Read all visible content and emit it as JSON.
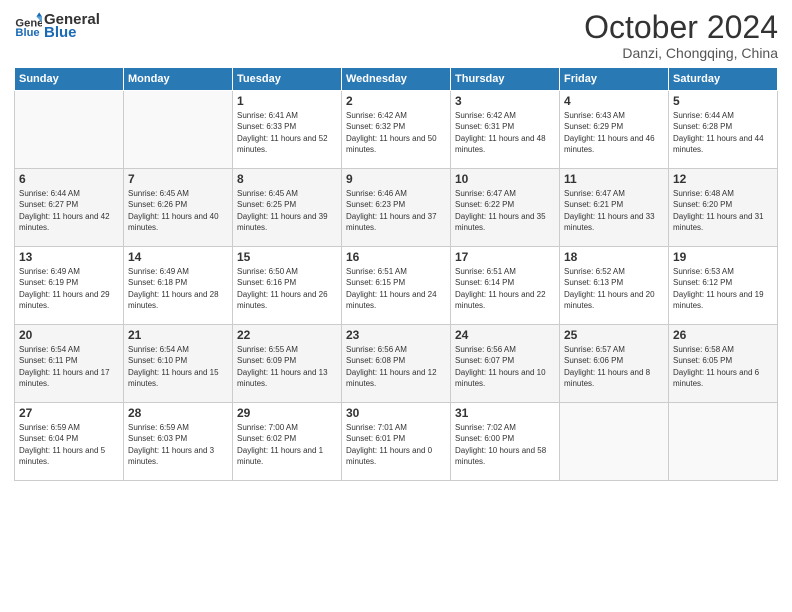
{
  "header": {
    "logo_general": "General",
    "logo_blue": "Blue",
    "month": "October 2024",
    "location": "Danzi, Chongqing, China"
  },
  "weekdays": [
    "Sunday",
    "Monday",
    "Tuesday",
    "Wednesday",
    "Thursday",
    "Friday",
    "Saturday"
  ],
  "rows": [
    [
      {
        "day": "",
        "info": ""
      },
      {
        "day": "",
        "info": ""
      },
      {
        "day": "1",
        "info": "Sunrise: 6:41 AM\nSunset: 6:33 PM\nDaylight: 11 hours and 52 minutes."
      },
      {
        "day": "2",
        "info": "Sunrise: 6:42 AM\nSunset: 6:32 PM\nDaylight: 11 hours and 50 minutes."
      },
      {
        "day": "3",
        "info": "Sunrise: 6:42 AM\nSunset: 6:31 PM\nDaylight: 11 hours and 48 minutes."
      },
      {
        "day": "4",
        "info": "Sunrise: 6:43 AM\nSunset: 6:29 PM\nDaylight: 11 hours and 46 minutes."
      },
      {
        "day": "5",
        "info": "Sunrise: 6:44 AM\nSunset: 6:28 PM\nDaylight: 11 hours and 44 minutes."
      }
    ],
    [
      {
        "day": "6",
        "info": "Sunrise: 6:44 AM\nSunset: 6:27 PM\nDaylight: 11 hours and 42 minutes."
      },
      {
        "day": "7",
        "info": "Sunrise: 6:45 AM\nSunset: 6:26 PM\nDaylight: 11 hours and 40 minutes."
      },
      {
        "day": "8",
        "info": "Sunrise: 6:45 AM\nSunset: 6:25 PM\nDaylight: 11 hours and 39 minutes."
      },
      {
        "day": "9",
        "info": "Sunrise: 6:46 AM\nSunset: 6:23 PM\nDaylight: 11 hours and 37 minutes."
      },
      {
        "day": "10",
        "info": "Sunrise: 6:47 AM\nSunset: 6:22 PM\nDaylight: 11 hours and 35 minutes."
      },
      {
        "day": "11",
        "info": "Sunrise: 6:47 AM\nSunset: 6:21 PM\nDaylight: 11 hours and 33 minutes."
      },
      {
        "day": "12",
        "info": "Sunrise: 6:48 AM\nSunset: 6:20 PM\nDaylight: 11 hours and 31 minutes."
      }
    ],
    [
      {
        "day": "13",
        "info": "Sunrise: 6:49 AM\nSunset: 6:19 PM\nDaylight: 11 hours and 29 minutes."
      },
      {
        "day": "14",
        "info": "Sunrise: 6:49 AM\nSunset: 6:18 PM\nDaylight: 11 hours and 28 minutes."
      },
      {
        "day": "15",
        "info": "Sunrise: 6:50 AM\nSunset: 6:16 PM\nDaylight: 11 hours and 26 minutes."
      },
      {
        "day": "16",
        "info": "Sunrise: 6:51 AM\nSunset: 6:15 PM\nDaylight: 11 hours and 24 minutes."
      },
      {
        "day": "17",
        "info": "Sunrise: 6:51 AM\nSunset: 6:14 PM\nDaylight: 11 hours and 22 minutes."
      },
      {
        "day": "18",
        "info": "Sunrise: 6:52 AM\nSunset: 6:13 PM\nDaylight: 11 hours and 20 minutes."
      },
      {
        "day": "19",
        "info": "Sunrise: 6:53 AM\nSunset: 6:12 PM\nDaylight: 11 hours and 19 minutes."
      }
    ],
    [
      {
        "day": "20",
        "info": "Sunrise: 6:54 AM\nSunset: 6:11 PM\nDaylight: 11 hours and 17 minutes."
      },
      {
        "day": "21",
        "info": "Sunrise: 6:54 AM\nSunset: 6:10 PM\nDaylight: 11 hours and 15 minutes."
      },
      {
        "day": "22",
        "info": "Sunrise: 6:55 AM\nSunset: 6:09 PM\nDaylight: 11 hours and 13 minutes."
      },
      {
        "day": "23",
        "info": "Sunrise: 6:56 AM\nSunset: 6:08 PM\nDaylight: 11 hours and 12 minutes."
      },
      {
        "day": "24",
        "info": "Sunrise: 6:56 AM\nSunset: 6:07 PM\nDaylight: 11 hours and 10 minutes."
      },
      {
        "day": "25",
        "info": "Sunrise: 6:57 AM\nSunset: 6:06 PM\nDaylight: 11 hours and 8 minutes."
      },
      {
        "day": "26",
        "info": "Sunrise: 6:58 AM\nSunset: 6:05 PM\nDaylight: 11 hours and 6 minutes."
      }
    ],
    [
      {
        "day": "27",
        "info": "Sunrise: 6:59 AM\nSunset: 6:04 PM\nDaylight: 11 hours and 5 minutes."
      },
      {
        "day": "28",
        "info": "Sunrise: 6:59 AM\nSunset: 6:03 PM\nDaylight: 11 hours and 3 minutes."
      },
      {
        "day": "29",
        "info": "Sunrise: 7:00 AM\nSunset: 6:02 PM\nDaylight: 11 hours and 1 minute."
      },
      {
        "day": "30",
        "info": "Sunrise: 7:01 AM\nSunset: 6:01 PM\nDaylight: 11 hours and 0 minutes."
      },
      {
        "day": "31",
        "info": "Sunrise: 7:02 AM\nSunset: 6:00 PM\nDaylight: 10 hours and 58 minutes."
      },
      {
        "day": "",
        "info": ""
      },
      {
        "day": "",
        "info": ""
      }
    ]
  ]
}
